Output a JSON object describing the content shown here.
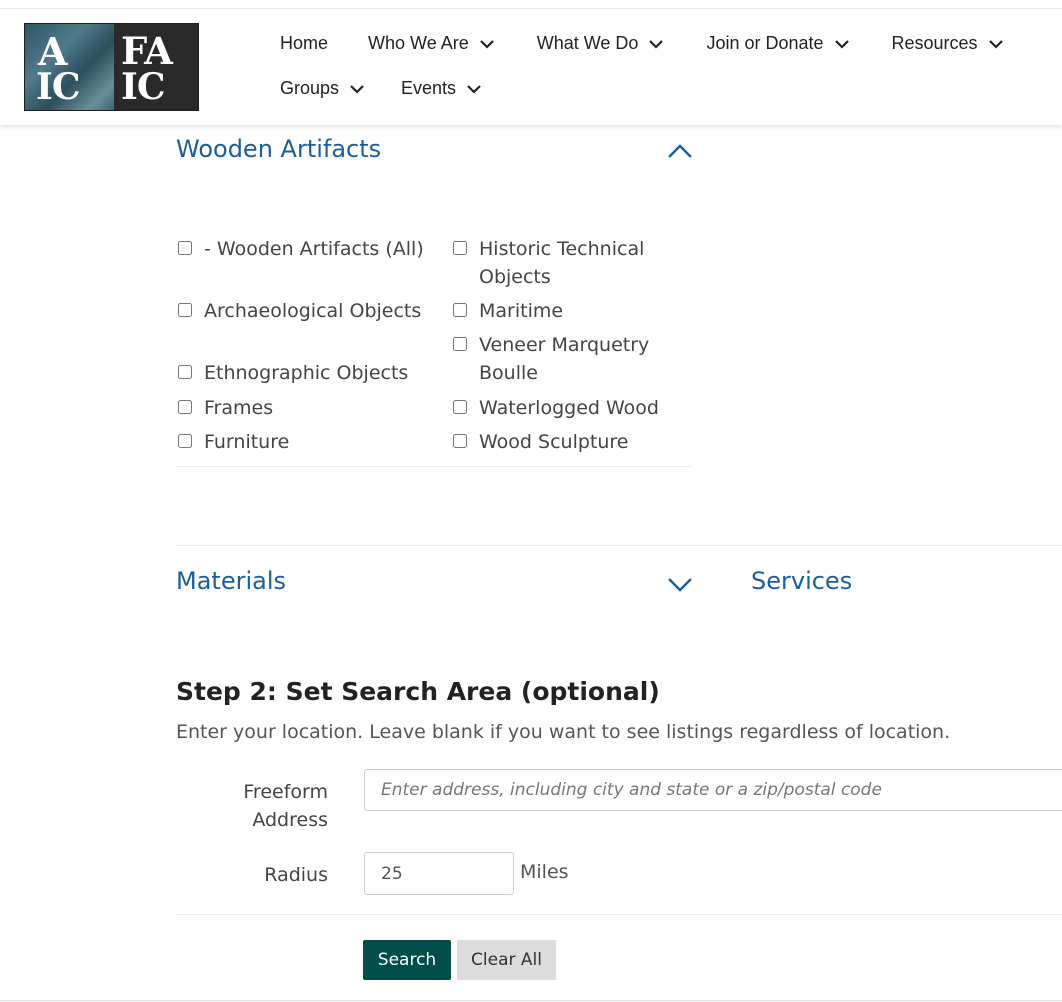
{
  "header": {
    "logo_left_text": "AIC",
    "logo_right_text": "FAIC",
    "nav_row1": [
      {
        "label": "Home",
        "has_dropdown": false
      },
      {
        "label": "Who We Are",
        "has_dropdown": true
      },
      {
        "label": "What We Do",
        "has_dropdown": true
      },
      {
        "label": "Join or Donate",
        "has_dropdown": true
      },
      {
        "label": "Resources",
        "has_dropdown": true
      }
    ],
    "nav_row2": [
      {
        "label": "Groups",
        "has_dropdown": true
      },
      {
        "label": "Events",
        "has_dropdown": true
      }
    ]
  },
  "wooden_artifacts": {
    "title": "Wooden Artifacts",
    "expanded": true,
    "col1": [
      "- Wooden Artifacts (All)",
      "Archaeological Objects",
      "Ethnographic Objects",
      "Frames",
      "Furniture"
    ],
    "col2": [
      "Historic Technical Objects",
      "Maritime",
      "Veneer Marquetry Boulle",
      "Waterlogged Wood",
      "Wood Sculpture"
    ]
  },
  "materials": {
    "title": "Materials",
    "expanded": false
  },
  "services": {
    "title": "Services"
  },
  "step2": {
    "title": "Step 2: Set Search Area (optional)",
    "description": "Enter your location. Leave blank if you want to see listings regardless of location.",
    "address_label": "Freeform Address",
    "address_placeholder": "Enter address, including city and state or a zip/postal code",
    "radius_label": "Radius",
    "radius_value": "25",
    "radius_units": "Miles"
  },
  "buttons": {
    "search": "Search",
    "clear_all": "Clear All"
  },
  "colors": {
    "link_blue": "#1a5e9a",
    "button_primary": "#004d4a",
    "button_secondary": "#dcdcdc"
  }
}
